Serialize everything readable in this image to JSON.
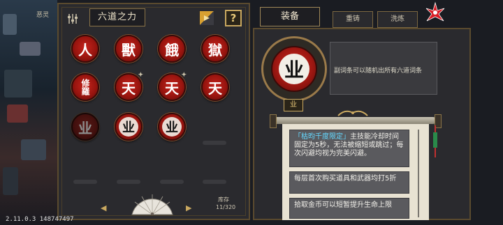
{
  "sidebar": {
    "label": "恶灵"
  },
  "version": "2.11.0.3 148747497",
  "left_panel": {
    "title": "六道之力",
    "help_label": "?",
    "tokens_row1": [
      "人",
      "獸",
      "餓",
      "獄"
    ],
    "tokens_row2": [
      "修羅",
      "天",
      "天",
      "天"
    ],
    "tokens_row3": [
      "业",
      "业",
      "业"
    ],
    "stock_label": "库存",
    "stock_count": "11/320"
  },
  "right_panel": {
    "tabs": [
      {
        "label": "装备"
      },
      {
        "label": "重铸"
      },
      {
        "label": "洗炼"
      }
    ],
    "big_token_glyph": "业",
    "badge_glyph": "业",
    "description": "副词条可以随机出所有六道词条",
    "effects": [
      {
        "highlight": "「枯昀千度限定」",
        "text": "主技能冷却时间固定为5秒，无法被缩短或跳过；每次闪避均视为完美闪避。"
      },
      {
        "highlight": "",
        "text": "每层首次购买道具和武器均打5折"
      },
      {
        "highlight": "",
        "text": "拾取金币可以短暂提升生命上限"
      }
    ]
  },
  "colors": {
    "panel_bg": "#2a2a2e",
    "gold_border": "#8a7448",
    "token_red": "#c4231c",
    "highlight_cyan": "#64d8ff",
    "scroll_paper": "#e8e2d2"
  }
}
